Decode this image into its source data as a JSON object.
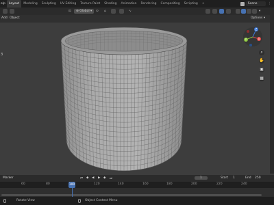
{
  "topbar": {
    "menu_label": "elp",
    "tabs": [
      "Layout",
      "Modeling",
      "Sculpting",
      "UV Editing",
      "Texture Paint",
      "Shading",
      "Animation",
      "Rendering",
      "Compositing",
      "Scripting"
    ],
    "active_tab": 0,
    "add_tab": "+",
    "scene_name": "Scene"
  },
  "toolrow": {
    "orientation": "Global",
    "options": "Options"
  },
  "row2": {
    "add": "Add",
    "object": "Object"
  },
  "viewport": {
    "left_number": "3",
    "gizmo_axes": {
      "x": "X",
      "y": "Y",
      "z": "Z"
    },
    "colors": {
      "x": "#e24b4b",
      "y": "#8ac43b",
      "z": "#3c78d8",
      "background": "#3d3d3d",
      "mesh_outer": "#a8a8a8",
      "mesh_inner": "#8a8a8a",
      "wire": "#505050"
    }
  },
  "timeline": {
    "marker": "Marker",
    "current_frame": "1",
    "start_label": "Start",
    "start_value": "1",
    "end_label": "End",
    "end_value": "250",
    "playhead_value": "1",
    "ruler_ticks": [
      "60",
      "80",
      "100",
      "120",
      "140",
      "160",
      "180",
      "200",
      "220",
      "240"
    ]
  },
  "status": {
    "left": "Rotate View",
    "right": "Object Context Menu"
  }
}
